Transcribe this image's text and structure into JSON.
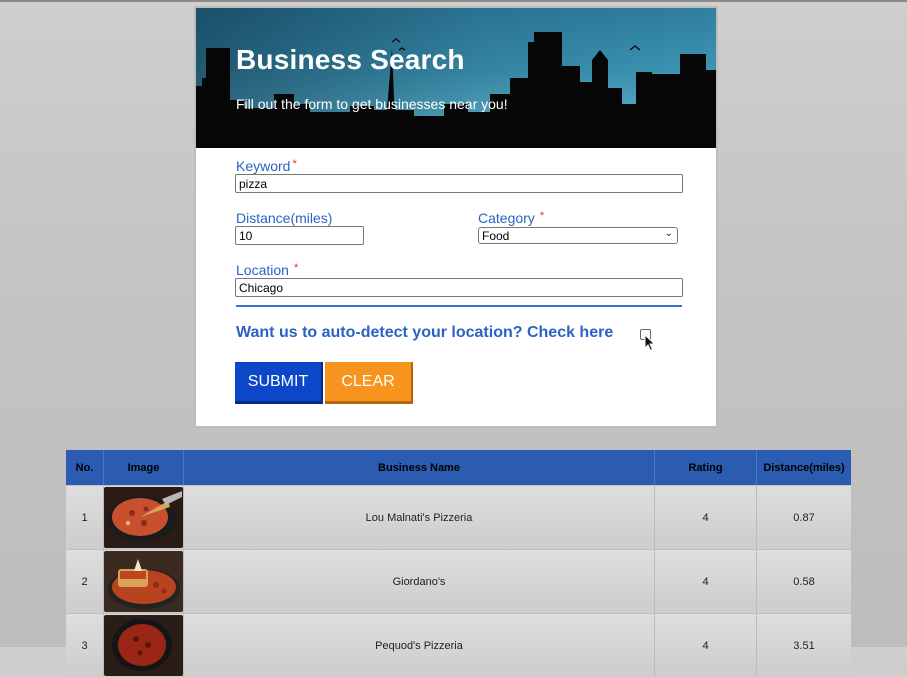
{
  "banner": {
    "title": "Business Search",
    "subtitle": "Fill out the form to get businesses near you!"
  },
  "form": {
    "keyword": {
      "label": "Keyword",
      "required_mark": "*",
      "value": "pizza"
    },
    "distance": {
      "label": "Distance(miles)",
      "value": "10"
    },
    "category": {
      "label": "Category",
      "required_mark": "*",
      "selected": "Food"
    },
    "location": {
      "label": "Location",
      "required_mark": "*",
      "value": "Chicago"
    },
    "autodetect_label": "Want us to auto-detect your location? Check here",
    "autodetect_checked": false,
    "submit_label": "SUBMIT",
    "clear_label": "CLEAR"
  },
  "colors": {
    "label_blue": "#2a63c4",
    "submit_bg": "#0d47c9",
    "clear_bg": "#f7941d",
    "table_header": "#2b5cb1"
  },
  "table": {
    "headers": [
      "No.",
      "Image",
      "Business Name",
      "Rating",
      "Distance(miles)"
    ],
    "rows": [
      {
        "no": "1",
        "image": "pizza-thumbnail",
        "name": "Lou Malnati's Pizzeria",
        "rating": "4",
        "distance": "0.87"
      },
      {
        "no": "2",
        "image": "pizza-thumbnail",
        "name": "Giordano's",
        "rating": "4",
        "distance": "0.58"
      },
      {
        "no": "3",
        "image": "pizza-thumbnail",
        "name": "Pequod's Pizzeria",
        "rating": "4",
        "distance": "3.51"
      }
    ]
  }
}
